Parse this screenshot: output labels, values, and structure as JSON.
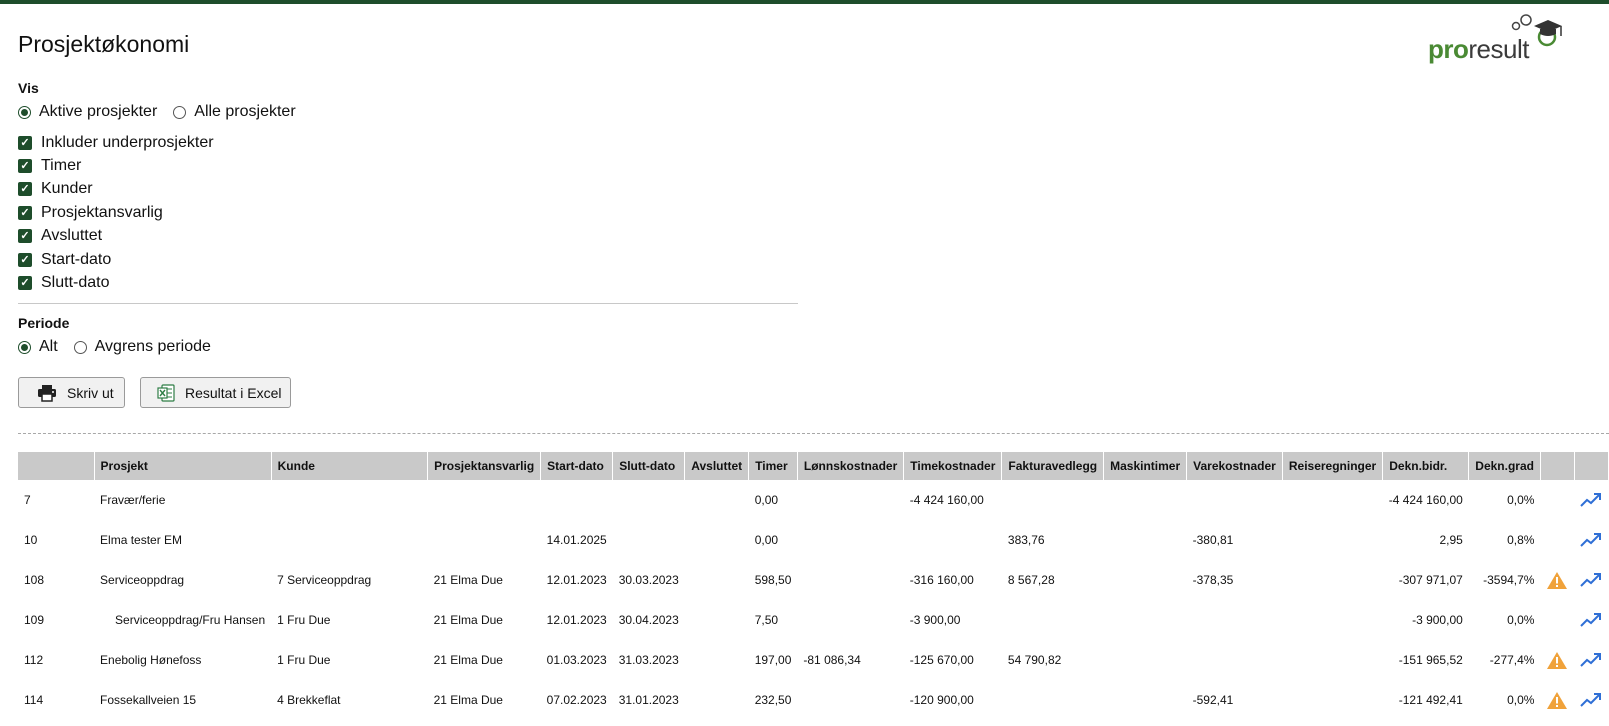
{
  "page": {
    "title": "Prosjektøkonomi"
  },
  "logo": {
    "text_a": "pro",
    "text_b": "result"
  },
  "vis": {
    "label": "Vis",
    "radios": [
      {
        "label": "Aktive prosjekter",
        "checked": true
      },
      {
        "label": "Alle prosjekter",
        "checked": false
      }
    ],
    "checkboxes": [
      {
        "label": "Inkluder underprosjekter",
        "checked": true
      },
      {
        "label": "Timer",
        "checked": true
      },
      {
        "label": "Kunder",
        "checked": true
      },
      {
        "label": "Prosjektansvarlig",
        "checked": true
      },
      {
        "label": "Avsluttet",
        "checked": true
      },
      {
        "label": "Start-dato",
        "checked": true
      },
      {
        "label": "Slutt-dato",
        "checked": true
      }
    ]
  },
  "periode": {
    "label": "Periode",
    "radios": [
      {
        "label": "Alt",
        "checked": true
      },
      {
        "label": "Avgrens periode",
        "checked": false
      }
    ]
  },
  "buttons": {
    "print": "Skriv ut",
    "excel": "Resultat i Excel"
  },
  "table": {
    "headers": [
      "",
      "Prosjekt",
      "Kunde",
      "Prosjektansvarlig",
      "Start-dato",
      "Slutt-dato",
      "Avsluttet",
      "Timer",
      "Lønnskostnader",
      "Timekostnader",
      "Fakturavedlegg",
      "Maskintimer",
      "Varekostnader",
      "Reiseregninger",
      "Dekn.bidr.",
      "Dekn.grad",
      "",
      ""
    ],
    "rows": [
      {
        "nr": "7",
        "prosjekt": "Fravær/ferie",
        "kunde": "",
        "ansvarlig": "",
        "start": "",
        "slutt": "",
        "avsluttet": "",
        "timer": "0,00",
        "lonn": "",
        "timekost": "-4 424 160,00",
        "faktura": "",
        "maskin": "",
        "vare": "",
        "reise": "",
        "dekn_bidr": "-4 424 160,00",
        "dekn_grad": "0,0%",
        "warning": false,
        "sub": false
      },
      {
        "nr": "10",
        "prosjekt": "Elma tester EM",
        "kunde": "",
        "ansvarlig": "",
        "start": "14.01.2025",
        "slutt": "",
        "avsluttet": "",
        "timer": "0,00",
        "lonn": "",
        "timekost": "",
        "faktura": "383,76",
        "maskin": "",
        "vare": "-380,81",
        "reise": "",
        "dekn_bidr": "2,95",
        "dekn_grad": "0,8%",
        "warning": false,
        "sub": false
      },
      {
        "nr": "108",
        "prosjekt": "Serviceoppdrag",
        "kunde": "7 Serviceoppdrag",
        "ansvarlig": "21 Elma Due",
        "start": "12.01.2023",
        "slutt": "30.03.2023",
        "avsluttet": "",
        "timer": "598,50",
        "lonn": "",
        "timekost": "-316 160,00",
        "faktura": "8 567,28",
        "maskin": "",
        "vare": "-378,35",
        "reise": "",
        "dekn_bidr": "-307 971,07",
        "dekn_grad": "-3594,7%",
        "warning": true,
        "sub": false
      },
      {
        "nr": "109",
        "prosjekt": "Serviceoppdrag/Fru Hansen",
        "kunde": "1 Fru Due",
        "ansvarlig": "21 Elma Due",
        "start": "12.01.2023",
        "slutt": "30.04.2023",
        "avsluttet": "",
        "timer": "7,50",
        "lonn": "",
        "timekost": "-3 900,00",
        "faktura": "",
        "maskin": "",
        "vare": "",
        "reise": "",
        "dekn_bidr": "-3 900,00",
        "dekn_grad": "0,0%",
        "warning": false,
        "sub": true
      },
      {
        "nr": "112",
        "prosjekt": "Enebolig Hønefoss",
        "kunde": "1 Fru Due",
        "ansvarlig": "21 Elma Due",
        "start": "01.03.2023",
        "slutt": "31.03.2023",
        "avsluttet": "",
        "timer": "197,00",
        "lonn": "-81 086,34",
        "timekost": "-125 670,00",
        "faktura": "54 790,82",
        "maskin": "",
        "vare": "",
        "reise": "",
        "dekn_bidr": "-151 965,52",
        "dekn_grad": "-277,4%",
        "warning": true,
        "sub": false
      },
      {
        "nr": "114",
        "prosjekt": "Fossekallveien 15",
        "kunde": "4 Brekkeflat",
        "ansvarlig": "21 Elma Due",
        "start": "07.02.2023",
        "slutt": "31.01.2023",
        "avsluttet": "",
        "timer": "232,50",
        "lonn": "",
        "timekost": "-120 900,00",
        "faktura": "",
        "maskin": "",
        "vare": "-592,41",
        "reise": "",
        "dekn_bidr": "-121 492,41",
        "dekn_grad": "0,0%",
        "warning": true,
        "sub": false
      }
    ]
  },
  "colors": {
    "accent": "#1e4d2b",
    "logo_green": "#4a8a34",
    "warning": "#f0a23a",
    "trend": "#2f6fd6",
    "header_bg": "#c9c9c9"
  }
}
